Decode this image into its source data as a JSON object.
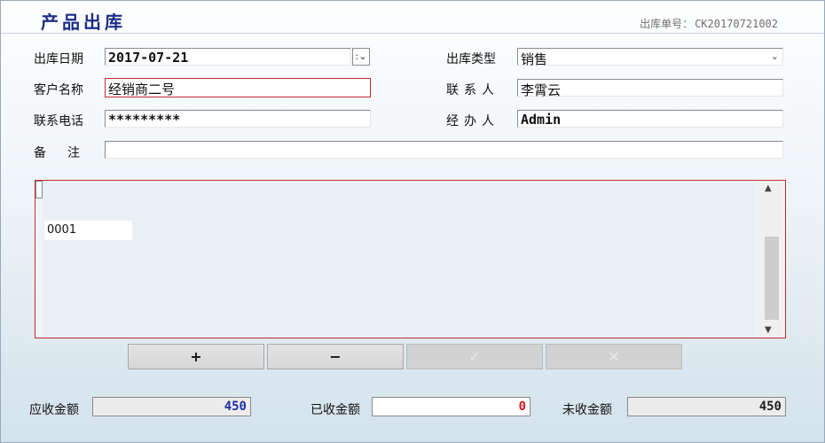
{
  "form": {
    "title": "产品出库",
    "order_no_label": "出库单号：",
    "order_no_value": "CK20170721002",
    "date_label": "出库日期",
    "date_value": "2017-07-21",
    "type_label": "出库类型",
    "type_value": "销售",
    "customer_label": "客户名称",
    "customer_value": "经销商二号",
    "contact_label": "联系人",
    "contact_value": "李霄云",
    "phone_label": "联系电话",
    "phone_value": "*********",
    "handler_label": "经办人",
    "handler_value": "Admin",
    "note_label": "备注",
    "note_value": ""
  },
  "grid": {
    "rows": [
      {
        "code": "0001"
      }
    ]
  },
  "buttons": {
    "add": "+",
    "remove": "−",
    "confirm": "✓",
    "cancel": "✕"
  },
  "totals": {
    "receivable_label": "应收金额",
    "receivable_value": "450",
    "received_label": "已收金额",
    "received_value": "0",
    "unpaid_label": "未收金额",
    "unpaid_value": "450"
  },
  "colors": {
    "title": "#1b2d86",
    "received_value": "#d21a1a",
    "receivable_value": "#1f2ea6",
    "invalid_border": "#c42a2a"
  },
  "icons": {
    "dropdown": "chevron-down-icon",
    "spin": "spinner-icon",
    "scroll_up": "chevron-up-icon",
    "scroll_down": "chevron-down-icon"
  }
}
